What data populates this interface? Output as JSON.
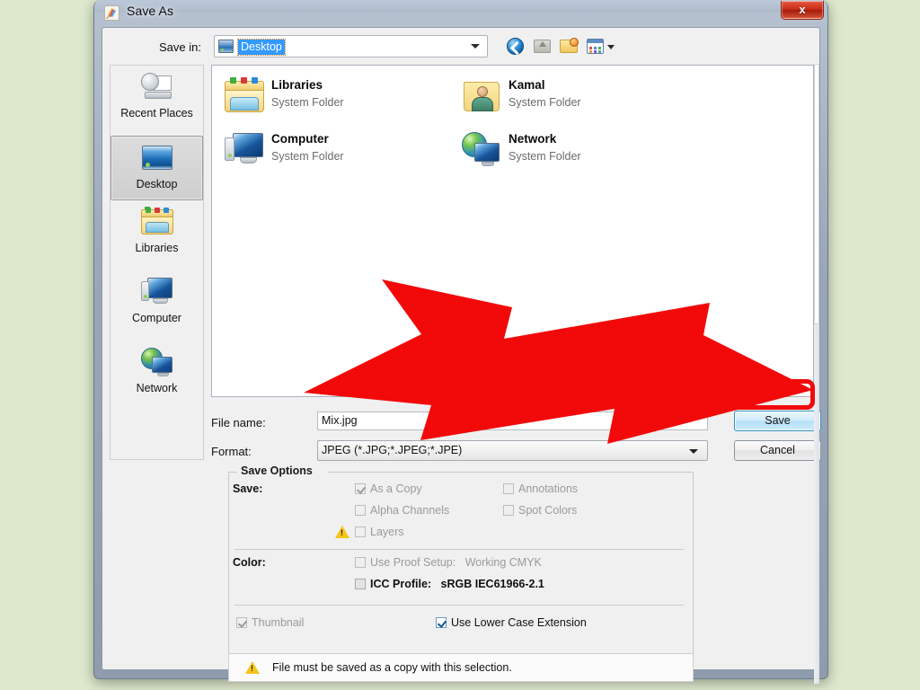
{
  "window": {
    "title": "Save As",
    "app_icon": "photoshop-icon",
    "close_label": "x"
  },
  "toolbar": {
    "save_in_label": "Save in:",
    "save_in_value": "Desktop",
    "buttons": [
      {
        "name": "back-icon",
        "label": "Back"
      },
      {
        "name": "up-folder-icon",
        "label": "Up One Level"
      },
      {
        "name": "new-folder-icon",
        "label": "Create New Folder"
      },
      {
        "name": "views-icon",
        "label": "Views"
      }
    ]
  },
  "places": {
    "items": [
      {
        "label": "Recent Places",
        "icon": "recent-places-icon",
        "selected": false
      },
      {
        "label": "Desktop",
        "icon": "desktop-icon",
        "selected": true
      },
      {
        "label": "Libraries",
        "icon": "libraries-icon",
        "selected": false
      },
      {
        "label": "Computer",
        "icon": "computer-icon",
        "selected": false
      },
      {
        "label": "Network",
        "icon": "network-icon",
        "selected": false
      }
    ]
  },
  "filelist": {
    "items": [
      {
        "name": "Libraries",
        "type": "System Folder",
        "icon": "libraries-folder-icon"
      },
      {
        "name": "Kamal",
        "type": "System Folder",
        "icon": "user-folder-icon"
      },
      {
        "name": "Computer",
        "type": "System Folder",
        "icon": "computer-icon"
      },
      {
        "name": "Network",
        "type": "System Folder",
        "icon": "network-icon"
      }
    ]
  },
  "fields": {
    "file_name_label": "File name:",
    "file_name_value": "Mix.jpg",
    "format_label": "Format:",
    "format_value": "JPEG (*.JPG;*.JPEG;*.JPE)"
  },
  "buttons": {
    "save": "Save",
    "cancel": "Cancel"
  },
  "save_options": {
    "group_title": "Save Options",
    "save_label": "Save:",
    "color_label": "Color:",
    "checkboxes": {
      "as_a_copy": {
        "label": "As a Copy",
        "checked": true,
        "enabled": false
      },
      "annotations": {
        "label": "Annotations",
        "checked": false,
        "enabled": false
      },
      "alpha_channels": {
        "label": "Alpha Channels",
        "checked": false,
        "enabled": false
      },
      "spot_colors": {
        "label": "Spot Colors",
        "checked": false,
        "enabled": false
      },
      "layers": {
        "label": "Layers",
        "checked": false,
        "enabled": false,
        "warning": true
      },
      "use_proof_setup": {
        "label": "Use Proof Setup:",
        "value": "Working CMYK",
        "checked": false,
        "enabled": false
      },
      "icc_profile": {
        "label": "ICC Profile:",
        "value": "sRGB IEC61966-2.1",
        "checked": false,
        "enabled": true
      },
      "thumbnail": {
        "label": "Thumbnail",
        "checked": true,
        "enabled": false
      },
      "use_lower_case_extension": {
        "label": "Use Lower Case Extension",
        "checked": true,
        "enabled": true
      }
    }
  },
  "warning": {
    "icon": "warning-triangle-icon",
    "message": "File must be saved as a copy with this selection."
  },
  "annotation": {
    "arrow_color": "#f20a0a",
    "highlight_target": "Save",
    "highlight_color": "#f20a0a"
  },
  "colors": {
    "page_background": "#dde8cc",
    "dialog_background": "#f0f0f0",
    "selection_blue": "#3399ff",
    "accent_red": "#f20a0a"
  }
}
